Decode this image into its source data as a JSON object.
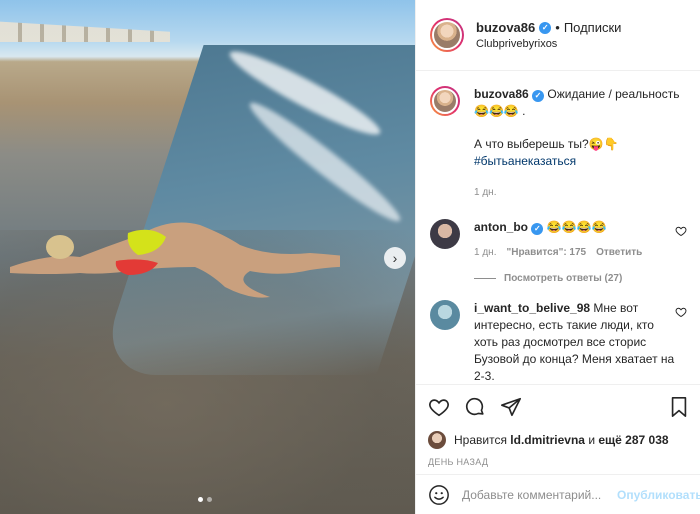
{
  "post": {
    "author": "buzova86",
    "header_separator": "•",
    "follow_label": "Подписки",
    "location": "Clubprivebyrixos"
  },
  "caption": {
    "username": "buzova86",
    "text_line1": "Ожидание / реальность",
    "text_line1_emoji": "😂😂😂 .",
    "text_line2": "А что выберешь ты?😜👇",
    "hashtag": "#бытьанеказаться",
    "time": "1 дн."
  },
  "comments": [
    {
      "username": "anton_bo",
      "text": "😂😂😂😂",
      "time": "1 дн.",
      "likes": "\"Нравится\": 175",
      "reply_label": "Ответить",
      "view_replies": "Посмотреть ответы (27)"
    },
    {
      "username": "i_want_to_belive_98",
      "text": "Мне вот интересно, есть такие люди, кто хоть раз досмотрел все сторис Бузовой до конца? Меня хватает на 2-3."
    }
  ],
  "likes": {
    "prefix": "Нравится",
    "user": "ld.dmitrievna",
    "middle": "и",
    "count": "ещё 287 038"
  },
  "date": "ДЕНЬ НАЗАД",
  "comment_box": {
    "placeholder": "Добавьте комментарий...",
    "publish_label": "Опубликовать"
  },
  "carousel": {
    "slide_count": 2,
    "active_index": 0
  },
  "colors": {
    "link_blue": "#3897f0",
    "hashtag": "#00376b",
    "muted": "#8e8e8e",
    "publish_disabled": "#b2dffc"
  },
  "icons": [
    "heart-icon",
    "comment-icon",
    "share-icon",
    "bookmark-icon",
    "emoji-icon",
    "chevron-right-icon",
    "verified-icon"
  ]
}
